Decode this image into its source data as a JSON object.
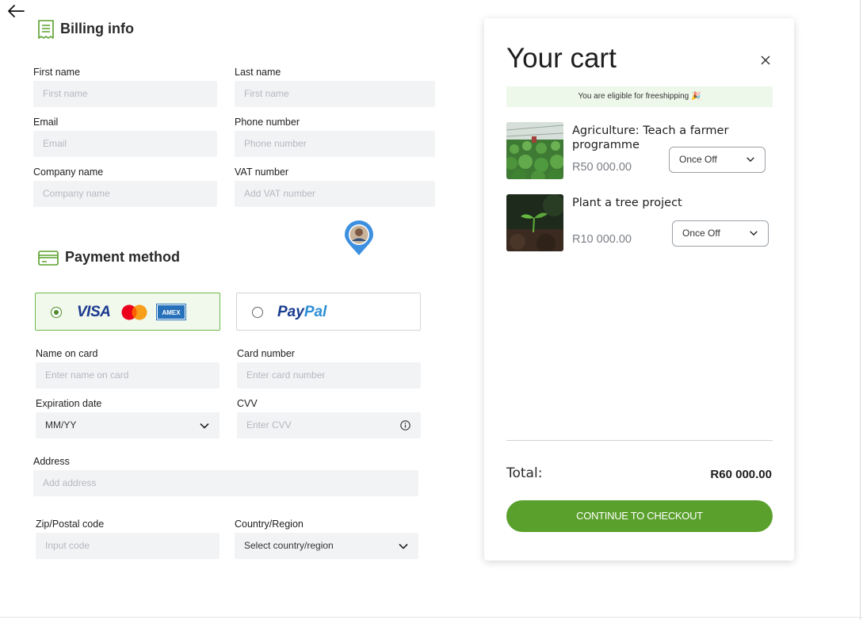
{
  "billing": {
    "title": "Billing info",
    "first_name": {
      "label": "First name",
      "placeholder": "First name"
    },
    "last_name": {
      "label": "Last name",
      "placeholder": "First name"
    },
    "email": {
      "label": "Email",
      "placeholder": "Email"
    },
    "phone": {
      "label": "Phone number",
      "placeholder": "Phone number"
    },
    "company": {
      "label": "Company name",
      "placeholder": "Company name"
    },
    "vat": {
      "label": "VAT number",
      "placeholder": "Add VAT number"
    }
  },
  "payment": {
    "title": "Payment method",
    "card_brands": [
      "VISA",
      "AMEX"
    ],
    "paypal": {
      "pay": "Pay",
      "pal": "Pal"
    },
    "name_on_card": {
      "label": "Name on card",
      "placeholder": "Enter name on card"
    },
    "card_number": {
      "label": "Card number",
      "placeholder": "Enter card number"
    },
    "expiration": {
      "label": "Expiration date",
      "value": "MM/YY"
    },
    "cvv": {
      "label": "CVV",
      "placeholder": "Enter CVV"
    },
    "address": {
      "label": "Address",
      "placeholder": "Add address"
    },
    "zip": {
      "label": "Zip/Postal code",
      "placeholder": "Input code"
    },
    "country": {
      "label": "Country/Region",
      "value": "Select country/region"
    }
  },
  "cart": {
    "title": "Your cart",
    "shipping_notice": "You are eligible for freeshipping 🎉",
    "items": [
      {
        "name": "Agriculture: Teach a farmer programme",
        "price": "R50 000.00",
        "frequency": "Once Off"
      },
      {
        "name": "Plant a tree project",
        "price": "R10 000.00",
        "frequency": "Once Off"
      }
    ],
    "total_label": "Total:",
    "total_value": "R60 000.00",
    "checkout_label": "CONTINUE TO CHECKOUT"
  },
  "colors": {
    "accent": "#5aa02c",
    "notice_bg": "#eef8ea",
    "input_bg": "#f2f3f5",
    "paypal_dark": "#1b3d8f",
    "paypal_light": "#2b8fd6"
  }
}
